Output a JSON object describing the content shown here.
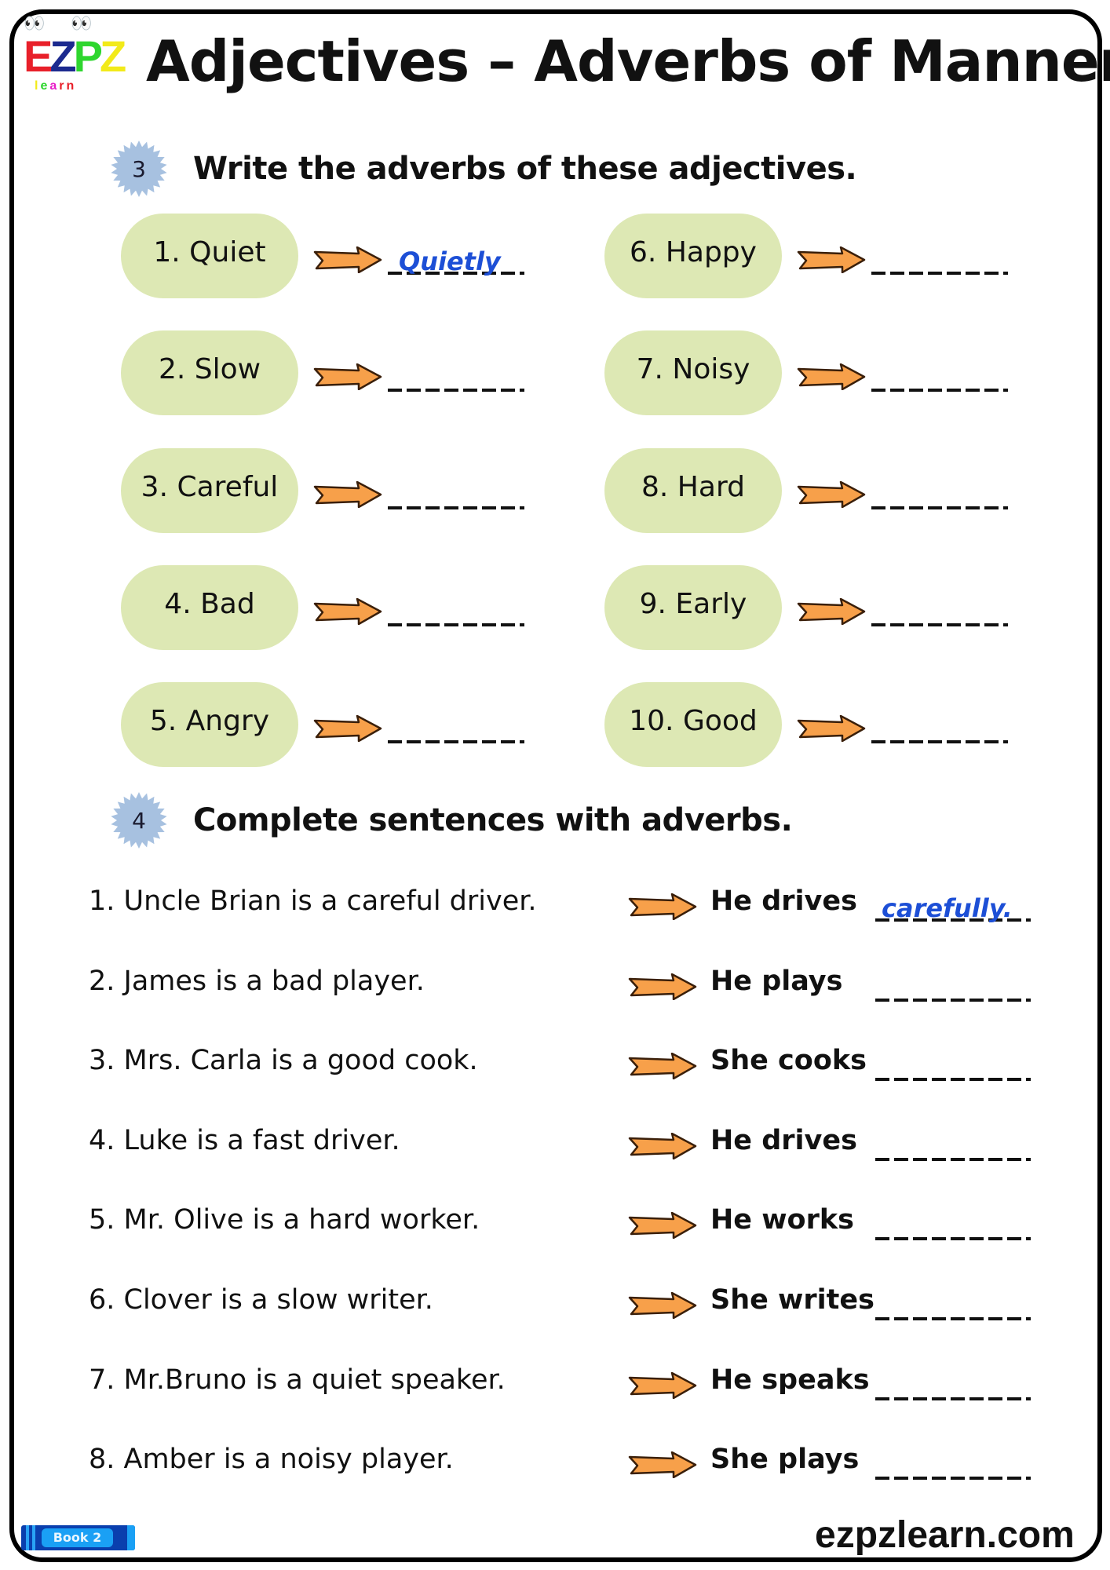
{
  "logo": {
    "letters": [
      {
        "char": "E",
        "color": "#e8202a"
      },
      {
        "char": "Z",
        "color": "#1c2a8f"
      },
      {
        "char": "P",
        "color": "#2ed62e"
      },
      {
        "char": "Z",
        "color": "#f2ea1a"
      }
    ],
    "learn": [
      {
        "char": "l",
        "color": "#f2ea1a"
      },
      {
        "char": "e",
        "color": "#2ed62e"
      },
      {
        "char": "a",
        "color": "#e81ec8"
      },
      {
        "char": "r",
        "color": "#e8202a"
      },
      {
        "char": "n",
        "color": "#e8202a"
      }
    ],
    "eyes": "👀"
  },
  "title": "Adjectives – Adverbs of Manner",
  "section3": {
    "number": "3",
    "title": "Write the adverbs of these adjectives.",
    "items": [
      {
        "label": "1. Quiet",
        "answer": "Quietly"
      },
      {
        "label": "2. Slow",
        "answer": ""
      },
      {
        "label": "3. Careful",
        "answer": ""
      },
      {
        "label": "4. Bad",
        "answer": ""
      },
      {
        "label": "5. Angry",
        "answer": ""
      },
      {
        "label": "6. Happy",
        "answer": ""
      },
      {
        "label": "7. Noisy",
        "answer": ""
      },
      {
        "label": "8. Hard",
        "answer": ""
      },
      {
        "label": "9. Early",
        "answer": ""
      },
      {
        "label": "10. Good",
        "answer": ""
      }
    ]
  },
  "section4": {
    "number": "4",
    "title": "Complete sentences with adverbs.",
    "rows": [
      {
        "sentence": "1. Uncle Brian is a careful driver.",
        "prompt": "He drives",
        "answer": "carefully."
      },
      {
        "sentence": "2. James is a bad player.",
        "prompt": "He plays",
        "answer": ""
      },
      {
        "sentence": "3. Mrs. Carla is a good cook.",
        "prompt": "She cooks",
        "answer": ""
      },
      {
        "sentence": "4. Luke is a fast driver.",
        "prompt": "He drives",
        "answer": ""
      },
      {
        "sentence": "5. Mr. Olive is a hard worker.",
        "prompt": "He works",
        "answer": ""
      },
      {
        "sentence": "6. Clover is a slow writer.",
        "prompt": "She writes",
        "answer": ""
      },
      {
        "sentence": "7. Mr.Bruno is a quiet speaker.",
        "prompt": "He speaks",
        "answer": ""
      },
      {
        "sentence": "8. Amber is a noisy player.",
        "prompt": "She plays",
        "answer": ""
      }
    ]
  },
  "footer": {
    "book_label": "Book 2",
    "website": "ezpzlearn.com"
  },
  "colors": {
    "pill": "#dde8b4",
    "arrow_fill": "#f7a04a",
    "arrow_stroke": "#3a1f0a",
    "badge": "#a7c1e0",
    "answer_ink": "#1d4fd6"
  }
}
